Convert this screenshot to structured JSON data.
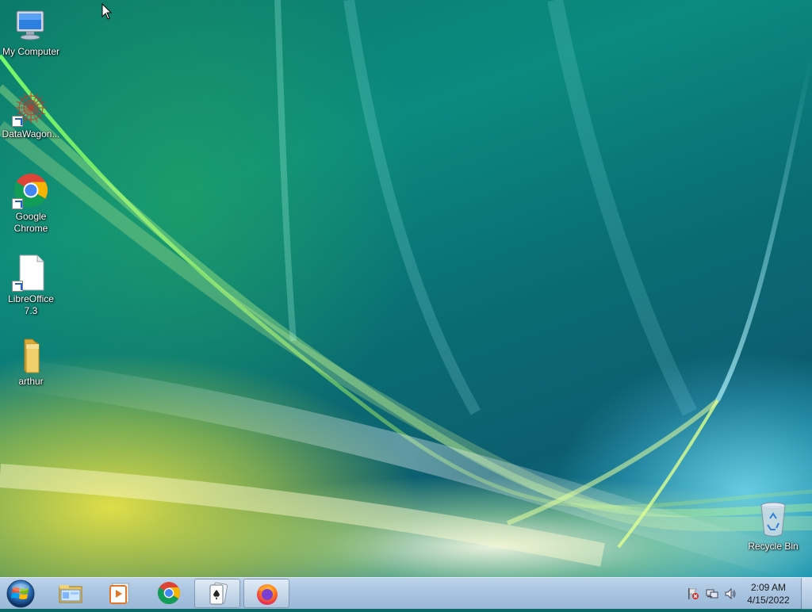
{
  "desktop": {
    "icons": [
      {
        "label": "My Computer",
        "icon": "computer-icon",
        "shortcut": false
      },
      {
        "label": "DataWagon...",
        "icon": "datawagon-icon",
        "shortcut": true
      },
      {
        "label": "Google Chrome",
        "icon": "chrome-icon",
        "shortcut": true
      },
      {
        "label": "LibreOffice 7.3",
        "icon": "libreoffice-icon",
        "shortcut": true
      },
      {
        "label": "arthur",
        "icon": "folder-icon",
        "shortcut": false
      },
      {
        "label": "Recycle Bin",
        "icon": "recycle-bin-icon",
        "shortcut": false
      }
    ]
  },
  "taskbar": {
    "start_icon": "windows-start-icon",
    "pinned": [
      {
        "icon": "file-explorer-icon",
        "active": false
      },
      {
        "icon": "media-player-icon",
        "active": false
      },
      {
        "icon": "chrome-icon",
        "active": false
      },
      {
        "icon": "solitaire-icon",
        "active": true
      },
      {
        "icon": "firefox-icon",
        "active": true
      }
    ],
    "tray": {
      "icons": [
        "action-center-flag-icon",
        "network-icon",
        "volume-icon"
      ],
      "time": "2:09 AM",
      "date": "4/15/2022"
    }
  },
  "colors": {
    "taskbar": "#a9c4e0",
    "wallpaper_teal": "#0b7a6a"
  }
}
